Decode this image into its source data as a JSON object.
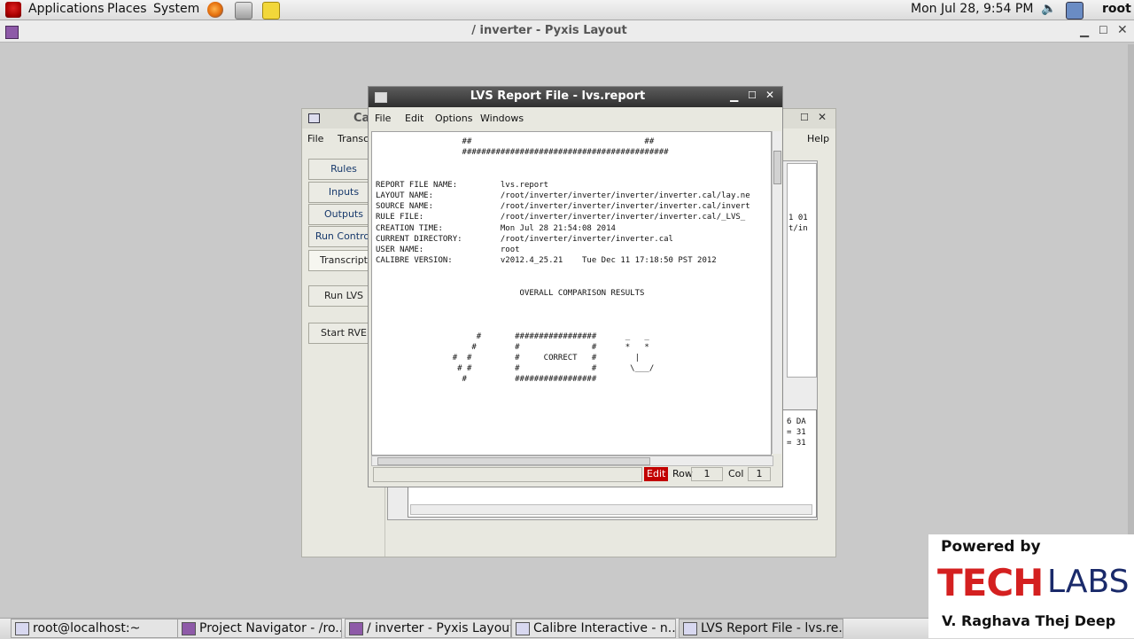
{
  "top_panel": {
    "menus": [
      "Applications",
      "Places",
      "System"
    ],
    "clock": "Mon Jul 28,  9:54 PM",
    "user": "root"
  },
  "pyxis": {
    "title": "/  inverter - Pyxis Layout"
  },
  "calibre": {
    "title_fragment": "Ca",
    "menus": [
      "File",
      "Transc",
      "Help"
    ],
    "buttons": [
      "Rules",
      "Inputs",
      "Outputs",
      "Run Control",
      "Transcript",
      "Run LVS",
      "Start RVE"
    ],
    "right_fragments": [
      "1 01",
      "t/in",
      "6 DA",
      "= 31",
      "= 31"
    ]
  },
  "lvs": {
    "title": "LVS Report File - lvs.report",
    "menus": [
      "File",
      "Edit",
      "Options",
      "Windows"
    ],
    "lines": [
      "                  ##                                    ##",
      "                  ###########################################",
      "",
      "",
      "REPORT FILE NAME:         lvs.report",
      "LAYOUT NAME:              /root/inverter/inverter/inverter/inverter.cal/lay.ne",
      "SOURCE NAME:              /root/inverter/inverter/inverter/inverter.cal/invert",
      "RULE FILE:                /root/inverter/inverter/inverter/inverter.cal/_LVS_",
      "CREATION TIME:            Mon Jul 28 21:54:08 2014",
      "CURRENT DIRECTORY:        /root/inverter/inverter/inverter.cal",
      "USER NAME:                root",
      "CALIBRE VERSION:          v2012.4_25.21    Tue Dec 11 17:18:50 PST 2012",
      "",
      "",
      "                              OVERALL COMPARISON RESULTS",
      "",
      "",
      "",
      "                     #       #################      _   _",
      "                    #        #               #      *   *",
      "                #  #         #     CORRECT   #        |",
      "                 # #         #               #       \\___/",
      "                  #          #################"
    ],
    "status": {
      "mode": "Edit",
      "row_label": "Row",
      "row": "1",
      "col_label": "Col",
      "col": "1"
    }
  },
  "taskbar": {
    "tasks": [
      "root@localhost:~",
      "Project Navigator - /ro...",
      "/  inverter - Pyxis Layout",
      "Calibre Interactive - n...",
      "LVS Report File - lvs.re..."
    ]
  },
  "watermark": {
    "line1": "Powered by",
    "brand_a": "TECH",
    "brand_b": "LABS",
    "author": "V. Raghava Thej Deep",
    "brand_color": "#d42020"
  }
}
